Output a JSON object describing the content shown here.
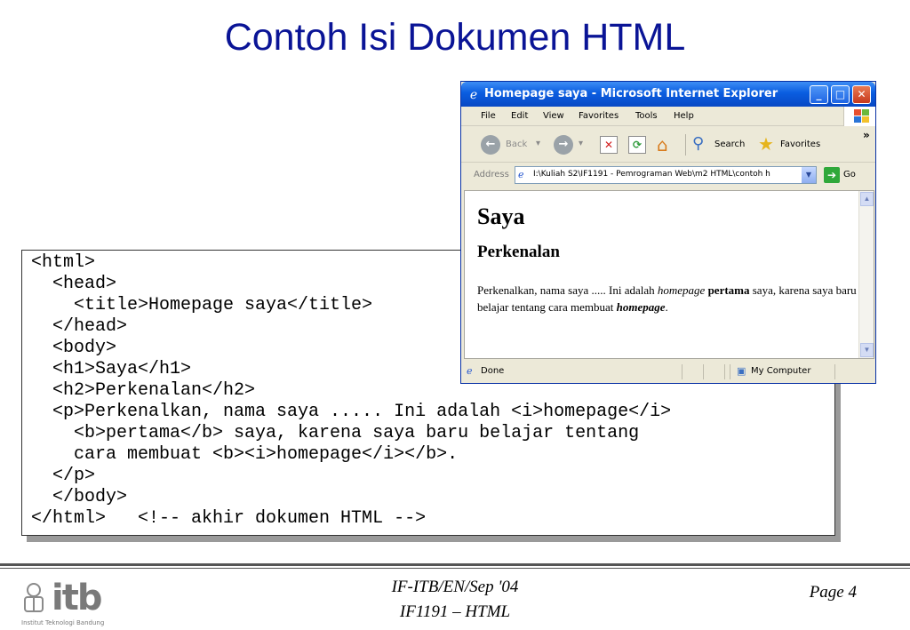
{
  "slide": {
    "title": "Contoh Isi Dokumen HTML"
  },
  "code": {
    "lines": [
      "<html>",
      "  <head>",
      "    <title>Homepage saya</title>",
      "  </head>",
      "  <body>",
      "  <h1>Saya</h1>",
      "  <h2>Perkenalan</h2>",
      "  <p>Perkenalkan, nama saya ..... Ini adalah <i>homepage</i>",
      "    <b>pertama</b> saya, karena saya baru belajar tentang",
      "    cara membuat <b><i>homepage</i></b>.",
      "  </p>",
      "  </body>",
      "</html>   <!-- akhir dokumen HTML -->"
    ]
  },
  "browser": {
    "window_title": "Homepage saya - Microsoft Internet Explorer",
    "window_buttons": {
      "minimize": "_",
      "maximize": "□",
      "close": "✕"
    },
    "menu": [
      "File",
      "Edit",
      "View",
      "Favorites",
      "Tools",
      "Help"
    ],
    "toolbar": {
      "back_label": "Back",
      "search_label": "Search",
      "favorites_label": "Favorites",
      "more_chevron": "»"
    },
    "address": {
      "label": "Address",
      "value": "I:\\Kuliah S2\\IF1191 - Pemrograman Web\\m2 HTML\\contoh h",
      "go_label": "Go"
    },
    "page": {
      "h1": "Saya",
      "h2": "Perkenalan",
      "p_part1": "Perkenalkan, nama saya ..... Ini adalah ",
      "p_italic": "homepage",
      "p_space": " ",
      "p_bold": "pertama",
      "p_part2": " saya, karena saya baru belajar tentang cara membuat ",
      "p_bold_italic": "homepage",
      "p_end": "."
    },
    "status": {
      "text": "Done",
      "zone": "My Computer"
    }
  },
  "footer": {
    "line1": "IF-ITB/EN/Sep '04",
    "line2": "IF1191 – HTML",
    "page": "Page 4",
    "logo_text": "itb",
    "logo_caption": "Institut Teknologi Bandung"
  },
  "colors": {
    "title": "#0a1496",
    "ie_title_bar": "#0a5de0"
  }
}
